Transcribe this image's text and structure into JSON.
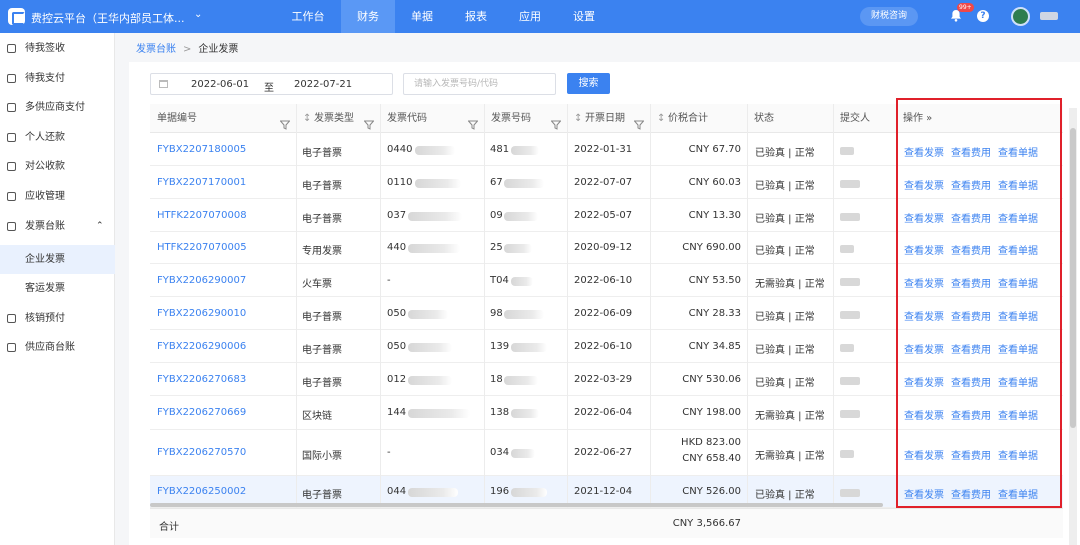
{
  "topbar": {
    "brand": "费控云平台（王华内部员工体...",
    "nav": [
      "工作台",
      "财务",
      "单据",
      "报表",
      "应用",
      "设置"
    ],
    "active_nav": "财务",
    "consult_label": "财税咨询",
    "badge": "99+",
    "help": "?"
  },
  "sidebar": {
    "items": [
      "待我签收",
      "待我支付",
      "多供应商支付",
      "个人还款",
      "对公收款",
      "应收管理",
      "发票台账"
    ],
    "sub_items": [
      "企业发票",
      "客运发票"
    ],
    "items_after": [
      "核销预付",
      "供应商台账"
    ],
    "active_sub": "企业发票"
  },
  "breadcrumb": {
    "parent": "发票台账",
    "current": "企业发票"
  },
  "filters": {
    "date_start": "2022-06-01",
    "date_sep": "至",
    "date_end": "2022-07-21",
    "search_placeholder": "请输入发票号码/代码",
    "search_button": "搜索"
  },
  "table": {
    "headers": [
      "单据编号",
      "发票类型",
      "发票代码",
      "发票号码",
      "开票日期",
      "价税合计",
      "状态",
      "提交人",
      "操作 »"
    ],
    "op_labels": [
      "查看发票",
      "查看费用",
      "查看单据"
    ],
    "rows": [
      {
        "no": "FYBX2207180005",
        "type": "电子普票",
        "code": "0440",
        "num": "481",
        "date": "2022-01-31",
        "amount": [
          "CNY 67.70"
        ],
        "status": "已验真 | 正常"
      },
      {
        "no": "FYBX2207170001",
        "type": "电子普票",
        "code": "0110",
        "num": "67",
        "date": "2022-07-07",
        "amount": [
          "CNY 60.03"
        ],
        "status": "已验真 | 正常"
      },
      {
        "no": "HTFK2207070008",
        "type": "电子普票",
        "code": "037",
        "num": "09",
        "date": "2022-05-07",
        "amount": [
          "CNY 13.30"
        ],
        "status": "已验真 | 正常"
      },
      {
        "no": "HTFK2207070005",
        "type": "专用发票",
        "code": "440",
        "num": "25",
        "date": "2020-09-12",
        "amount": [
          "CNY 690.00"
        ],
        "status": "已验真 | 正常"
      },
      {
        "no": "FYBX2206290007",
        "type": "火车票",
        "code": "-",
        "num": "T04",
        "date": "2022-06-10",
        "amount": [
          "CNY 53.50"
        ],
        "status": "无需验真 | 正常"
      },
      {
        "no": "FYBX2206290010",
        "type": "电子普票",
        "code": "050",
        "num": "98",
        "date": "2022-06-09",
        "amount": [
          "CNY 28.33"
        ],
        "status": "已验真 | 正常"
      },
      {
        "no": "FYBX2206290006",
        "type": "电子普票",
        "code": "050",
        "num": "139",
        "date": "2022-06-10",
        "amount": [
          "CNY 34.85"
        ],
        "status": "已验真 | 正常"
      },
      {
        "no": "FYBX2206270683",
        "type": "电子普票",
        "code": "012",
        "num": "18",
        "date": "2022-03-29",
        "amount": [
          "CNY 530.06"
        ],
        "status": "已验真 | 正常"
      },
      {
        "no": "FYBX2206270669",
        "type": "区块链",
        "code": "144",
        "num": "138",
        "date": "2022-06-04",
        "amount": [
          "CNY 198.00"
        ],
        "status": "无需验真 | 正常"
      },
      {
        "no": "FYBX2206270570",
        "type": "国际小票",
        "code": "-",
        "num": "034",
        "date": "2022-06-27",
        "amount": [
          "HKD 823.00",
          "CNY 658.40"
        ],
        "status": "无需验真 | 正常"
      },
      {
        "no": "FYBX2206250002",
        "type": "电子普票",
        "code": "044",
        "num": "196",
        "date": "2021-12-04",
        "amount": [
          "CNY 526.00"
        ],
        "status": "已验真 | 正常"
      }
    ],
    "total_label": "合计",
    "total_amount": "CNY 3,566.67"
  },
  "colors": {
    "primary": "#3b82f0",
    "highlight_box": "#e0202a"
  }
}
